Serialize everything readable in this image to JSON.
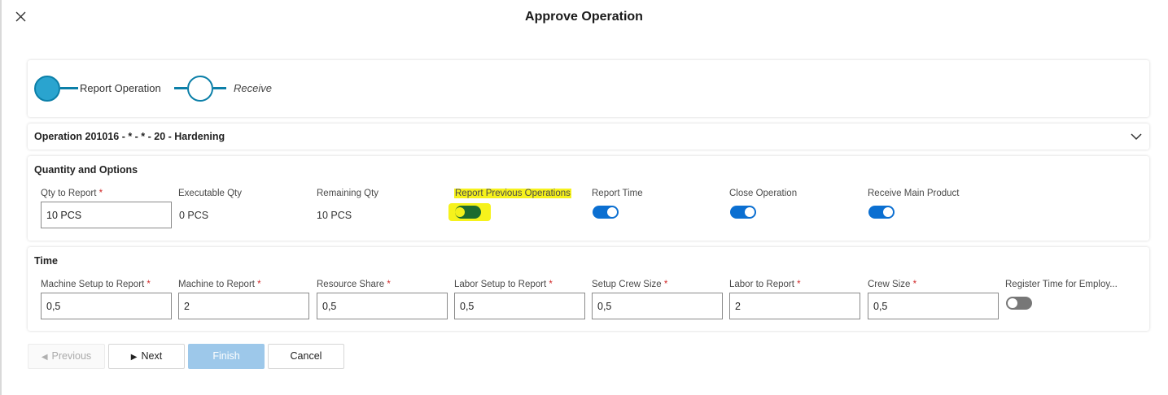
{
  "dialog": {
    "title": "Approve Operation"
  },
  "stepper": {
    "steps": [
      {
        "label": "Report Operation",
        "state": "active"
      },
      {
        "label": "Receive",
        "state": "pending"
      }
    ]
  },
  "operation": {
    "title": "Operation 201016 - * - * - 20 - Hardening"
  },
  "quantity_section": {
    "title": "Quantity and Options",
    "qty_to_report": {
      "label": "Qty to Report",
      "value": "10 PCS",
      "required": "*"
    },
    "executable_qty": {
      "label": "Executable Qty",
      "value": "0 PCS"
    },
    "remaining_qty": {
      "label": "Remaining Qty",
      "value": "10 PCS"
    },
    "report_previous_operations": {
      "label": "Report Previous Operations",
      "on": true
    },
    "report_time": {
      "label": "Report Time",
      "on": true
    },
    "close_operation": {
      "label": "Close Operation",
      "on": true
    },
    "receive_main_product": {
      "label": "Receive Main Product",
      "on": true
    }
  },
  "time_section": {
    "title": "Time",
    "machine_setup": {
      "label": "Machine Setup to Report",
      "value": "0,5",
      "required": "*"
    },
    "machine": {
      "label": "Machine to Report",
      "value": "2",
      "required": "*"
    },
    "resource_share": {
      "label": "Resource Share",
      "value": "0,5",
      "required": "*"
    },
    "labor_setup": {
      "label": "Labor Setup to Report",
      "value": "0,5",
      "required": "*"
    },
    "setup_crew": {
      "label": "Setup Crew Size",
      "value": "0,5",
      "required": "*"
    },
    "labor": {
      "label": "Labor to Report",
      "value": "2",
      "required": "*"
    },
    "crew_size": {
      "label": "Crew Size",
      "value": "0,5",
      "required": "*"
    },
    "register_time": {
      "label": "Register Time for Employ...",
      "on": false
    }
  },
  "footer": {
    "previous": "Previous",
    "next": "Next",
    "finish": "Finish",
    "cancel": "Cancel"
  },
  "colors": {
    "accent": "#0b7fa8",
    "toggle_on": "#0b6fd1",
    "highlight": "#f6f21c",
    "finish_disabled": "#9dc8ea"
  }
}
